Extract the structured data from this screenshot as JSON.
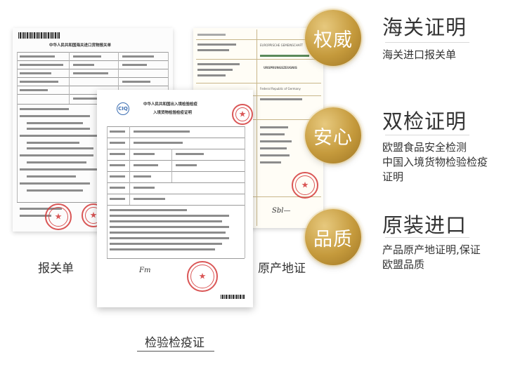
{
  "documents": {
    "customs": {
      "title": "中华人民共和国海关进口货物报关单",
      "caption": "报关单"
    },
    "origin": {
      "header": "EUROPÄISCHE GEMEINSCHAFT",
      "cert": "URSPRUNGSZEUGNIS",
      "country": "Federal Republic of Germany",
      "caption": "原产地证"
    },
    "inspection": {
      "title_line1": "中华人民共和国出入境检验检疫",
      "title_line2": "入境货物检验检疫证明",
      "caption": "检验检疫证"
    }
  },
  "features": [
    {
      "badge": "权威",
      "heading": "海关证明",
      "lines": [
        "海关进口报关单"
      ]
    },
    {
      "badge": "安心",
      "heading": "双检证明",
      "lines": [
        "欧盟食品安全检测",
        "中国入境货物检验检疫",
        "证明"
      ]
    },
    {
      "badge": "品质",
      "heading": "原装进口",
      "lines": [
        "产品原产地证明,保证",
        "欧盟品质"
      ]
    }
  ],
  "colors": {
    "gold": "#c59a3c",
    "stamp_red": "#d43a3a",
    "text": "#333333"
  }
}
